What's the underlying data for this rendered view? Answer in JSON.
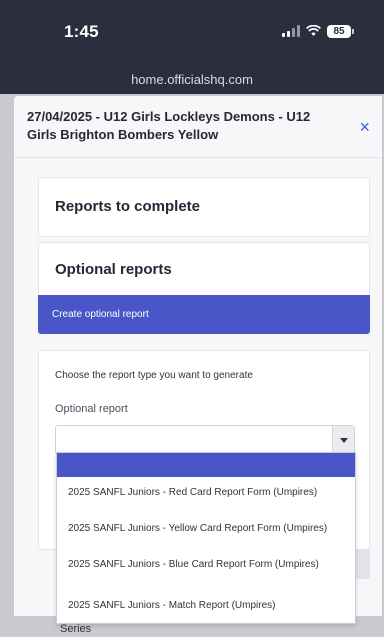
{
  "status_bar": {
    "time": "1:45",
    "battery": "85",
    "icons": [
      "signal-icon",
      "wifi-icon",
      "battery-icon"
    ]
  },
  "browser": {
    "url": "home.officialshq.com"
  },
  "modal": {
    "title": "27/04/2025 - U12 Girls Lockleys Demons - U12 Girls Brighton Bombers Yellow",
    "close_label": "×",
    "sections": {
      "reports_to_complete": "Reports to complete",
      "optional_reports": "Optional reports"
    },
    "create_button": "Create optional report",
    "form": {
      "helper": "Choose the report type you want to generate",
      "label": "Optional report",
      "selected_value": ""
    }
  },
  "dropdown": {
    "options": [
      "",
      "2025 SANFL Juniors - Red Card Report Form (Umpires)",
      "2025 SANFL Juniors - Yellow Card Report Form (Umpires)",
      "2025 SANFL Juniors - Blue Card Report Form (Umpires)",
      "2025 SANFL Juniors - Match Report (Umpires)"
    ]
  },
  "background": {
    "series_label": "Series"
  },
  "colors": {
    "accent": "#4856c8",
    "status_bar": "#2b2e3c",
    "close_icon": "#3f5bd6"
  }
}
